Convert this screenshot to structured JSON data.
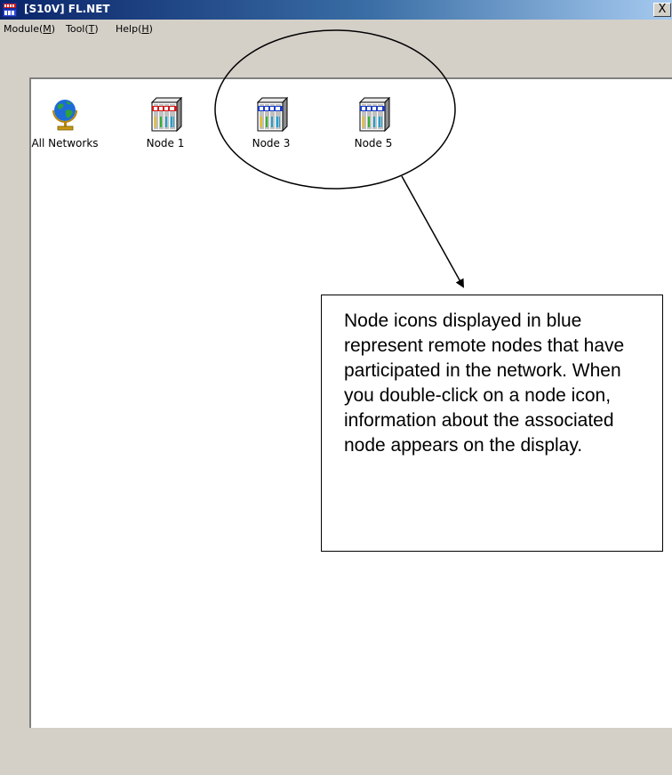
{
  "window": {
    "title": "[S10V] FL.NET",
    "close_label": "X",
    "app_icon": "s10v-module-icon"
  },
  "menu": {
    "items": [
      {
        "text": "Module(",
        "accel": "M",
        "close": ")"
      },
      {
        "text": "Tool(",
        "accel": "T",
        "close": ")"
      },
      {
        "text": "Help(",
        "accel": "H",
        "close": ")"
      }
    ]
  },
  "icons": [
    {
      "label": "All Networks",
      "icon": "globe-icon"
    },
    {
      "label": "Node 1",
      "icon": "node-icon-red"
    },
    {
      "label": "Node 3",
      "icon": "node-icon-blue"
    },
    {
      "label": "Node 5",
      "icon": "node-icon-blue"
    }
  ],
  "callout": {
    "text": "Node icons displayed in blue represent remote nodes that have participated in the network. When you double-click on a node icon, information about the associated node appears on the display."
  },
  "colors": {
    "titlebar_start": "#0a246a",
    "titlebar_end": "#a6caf0",
    "window_face": "#d4d0c8",
    "remote_node_blue": "#1a3cc8",
    "local_node_red": "#d01818"
  }
}
